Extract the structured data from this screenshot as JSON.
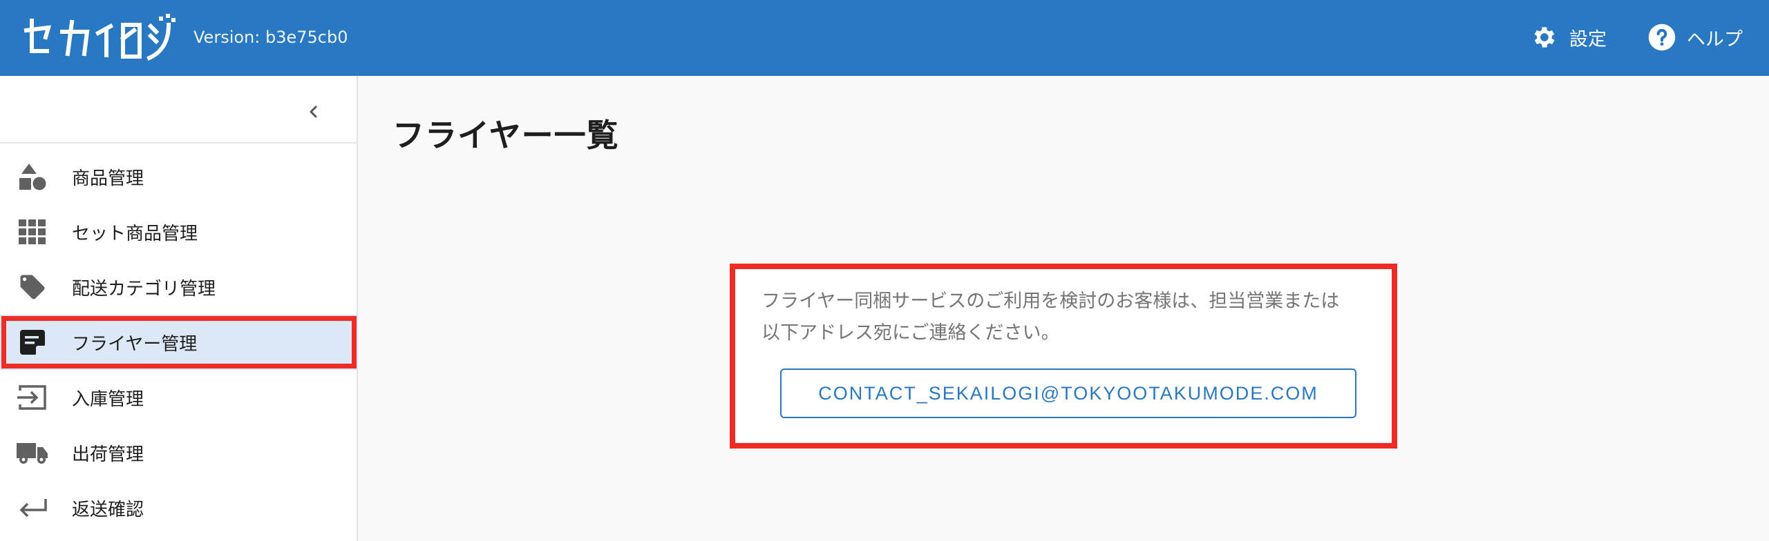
{
  "header": {
    "version": "Version: b3e75cb0",
    "settings_label": "設定",
    "help_label": "ヘルプ"
  },
  "sidebar": {
    "items": [
      {
        "label": "商品管理",
        "icon": "shapes-icon"
      },
      {
        "label": "セット商品管理",
        "icon": "grid-icon"
      },
      {
        "label": "配送カテゴリ管理",
        "icon": "tag-icon"
      },
      {
        "label": "フライヤー管理",
        "icon": "note-icon",
        "active": true
      },
      {
        "label": "入庫管理",
        "icon": "login-icon"
      },
      {
        "label": "出荷管理",
        "icon": "truck-icon"
      },
      {
        "label": "返送確認",
        "icon": "return-icon"
      }
    ]
  },
  "main": {
    "title": "フライヤー一覧",
    "notice_line1": "フライヤー同梱サービスのご利用を検討のお客様は、担当営業または",
    "notice_line2": "以下アドレス宛にご連絡ください。",
    "contact_label": "CONTACT_SEKAILOGI@TOKYOOTAKUMODE.COM"
  },
  "colors": {
    "brand": "#2878c4",
    "highlight": "#ee2b24",
    "active_bg": "#dce8f5"
  }
}
